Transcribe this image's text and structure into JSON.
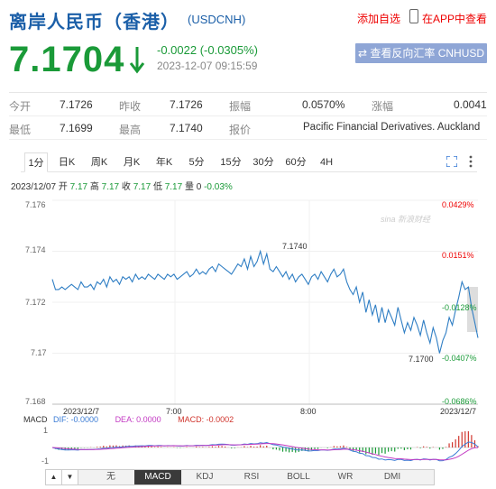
{
  "header": {
    "title": "离岸人民币（香港）",
    "code": "(USDCNH)",
    "add_watch": "添加自选",
    "app_link": "在APP中查看"
  },
  "quote": {
    "price": "7.1704",
    "change": "-0.0022 (-0.0305%)",
    "timestamp": "2023-12-07 09:15:59",
    "reverse_button": "查看反向汇率 CNHUSD",
    "direction": "down",
    "color": "#1a9a38"
  },
  "stats": {
    "rows": [
      [
        {
          "label": "今开",
          "value": "7.1726"
        },
        {
          "label": "昨收",
          "value": "7.1726"
        },
        {
          "label": "振幅",
          "value": "0.0570%"
        },
        {
          "label": "涨幅",
          "value": "0.0041"
        }
      ],
      [
        {
          "label": "最低",
          "value": "7.1699"
        },
        {
          "label": "最高",
          "value": "7.1740"
        },
        {
          "label": "报价",
          "value": "Pacific Financial Derivatives. Auckland"
        }
      ]
    ]
  },
  "tabs": [
    "1分",
    "日K",
    "周K",
    "月K",
    "年K",
    "5分",
    "15分",
    "30分",
    "60分",
    "4H"
  ],
  "active_tab": "1分",
  "ohlc": {
    "date": "2023/12/07",
    "open_label": "开",
    "open": "7.17",
    "high_label": "高",
    "high": "7.17",
    "close_label": "收",
    "close": "7.17",
    "low_label": "低",
    "low": "7.17",
    "volume_label": "量",
    "volume": "0",
    "pct": "-0.03%"
  },
  "chart_data": {
    "type": "line",
    "y_ticks": [
      "7.176",
      "7.174",
      "7.172",
      "7.17",
      "7.168"
    ],
    "y_range": [
      7.168,
      7.176
    ],
    "pct_ticks": [
      {
        "label": "0.0429%",
        "color": "#e00"
      },
      {
        "label": "0.0151%",
        "color": "#e00"
      },
      {
        "label": "-0.0128%",
        "color": "#1a9a38"
      },
      {
        "label": "-0.0407%",
        "color": "#1a9a38"
      },
      {
        "label": "-0.0686%",
        "color": "#1a9a38"
      }
    ],
    "x_ticks": [
      "2023/12/7",
      "7:00",
      "8:00",
      "2023/12/7"
    ],
    "high_label": "7.1740",
    "low_label": "7.1700",
    "series": [
      {
        "values": [
          7.1729,
          7.1725,
          7.1725,
          7.1726,
          7.1725,
          7.1726,
          7.1727,
          7.1726,
          7.1725,
          7.1728,
          7.1726,
          7.1726,
          7.1727,
          7.1725,
          7.1728,
          7.1727,
          7.1729,
          7.1726,
          7.173,
          7.1728,
          7.1729,
          7.1727,
          7.173,
          7.1729,
          7.173,
          7.1728,
          7.1731,
          7.1729,
          7.173,
          7.1729,
          7.1731,
          7.173,
          7.1729,
          7.1731,
          7.173,
          7.1729,
          7.1731,
          7.173,
          7.1731,
          7.1729,
          7.173,
          7.1731,
          7.1732,
          7.173,
          7.1731,
          7.1733,
          7.1731,
          7.1732,
          7.1731,
          7.1733,
          7.1734,
          7.1732,
          7.1735,
          7.1734,
          7.1733,
          7.1732,
          7.1731,
          7.1733,
          7.1735,
          7.1734,
          7.1737,
          7.1733,
          7.1738,
          7.1734,
          7.1736,
          7.174,
          7.1735,
          7.1739,
          7.1733,
          7.1732,
          7.1734,
          7.1732,
          7.173,
          7.1732,
          7.1729,
          7.1731,
          7.1728,
          7.173,
          7.1731,
          7.1729,
          7.1727,
          7.173,
          7.1731,
          7.1729,
          7.1732,
          7.173,
          7.1728,
          7.1731,
          7.1733,
          7.173,
          7.1731,
          7.1733,
          7.1728,
          7.1725,
          7.1723,
          7.1726,
          7.172,
          7.1724,
          7.1716,
          7.1721,
          7.1715,
          7.1719,
          7.1712,
          7.1718,
          7.1712,
          7.1717,
          7.1714,
          7.1711,
          7.1718,
          7.1713,
          7.1708,
          7.1712,
          7.1709,
          7.1714,
          7.1711,
          7.1707,
          7.1713,
          7.1708,
          7.1704,
          7.171,
          7.1706,
          7.17,
          7.1705,
          7.1708,
          7.1714,
          7.1711,
          7.1717,
          7.1722,
          7.1728,
          7.1725,
          7.1726,
          7.1718,
          7.1712,
          7.1706
        ]
      }
    ]
  },
  "macd": {
    "title": "MACD",
    "dif": "DIF: -0.0000",
    "dea": "DEA: 0.0000",
    "macd": "MACD: -0.0002",
    "y_ticks": [
      "1",
      "-1"
    ],
    "dif_color": "#3a7bd5",
    "dea_color": "#c33ac3",
    "macd_color": "#d0342c"
  },
  "indicators": [
    "无",
    "MACD",
    "KDJ",
    "RSI",
    "BOLL",
    "WR",
    "DMI"
  ],
  "active_indicator": "MACD",
  "watermark": "sina 新浪财经"
}
